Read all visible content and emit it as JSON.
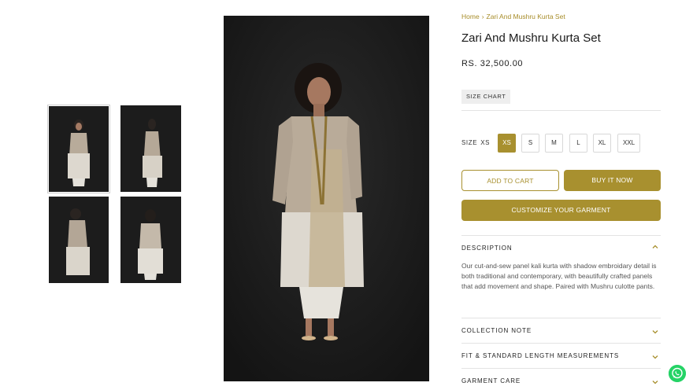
{
  "breadcrumb": {
    "home": "Home",
    "separator": "›",
    "current": "Zari And Mushru Kurta Set"
  },
  "product": {
    "title": "Zari And Mushru Kurta Set",
    "price": "RS. 32,500.00",
    "size_chart_label": "SIZE CHART"
  },
  "size": {
    "label": "SIZE",
    "selected": "XS",
    "options": [
      "XS",
      "S",
      "M",
      "L",
      "XL",
      "XXL"
    ]
  },
  "actions": {
    "add_to_cart": "ADD TO CART",
    "buy_now": "BUY IT NOW",
    "customize": "CUSTOMIZE YOUR GARMENT"
  },
  "accordion": {
    "description_title": "DESCRIPTION",
    "description_text": "Our cut-and-sew panel kali kurta with shadow embroidary detail is both traditional and contemporary, with beautifully crafted panels that add movement and shape. Paired with Mushru culotte pants.",
    "collection_note": "COLLECTION NOTE",
    "fit": "FIT & STANDARD LENGTH MEASUREMENTS",
    "care": "GARMENT CARE"
  },
  "icons": {
    "chevron_up": "chevron-up-icon",
    "chevron_down": "chevron-down-icon",
    "whatsapp": "whatsapp-icon"
  },
  "colors": {
    "accent": "#a8902f",
    "background_photo": "#1d1d1d",
    "whatsapp_green": "#25d366"
  }
}
